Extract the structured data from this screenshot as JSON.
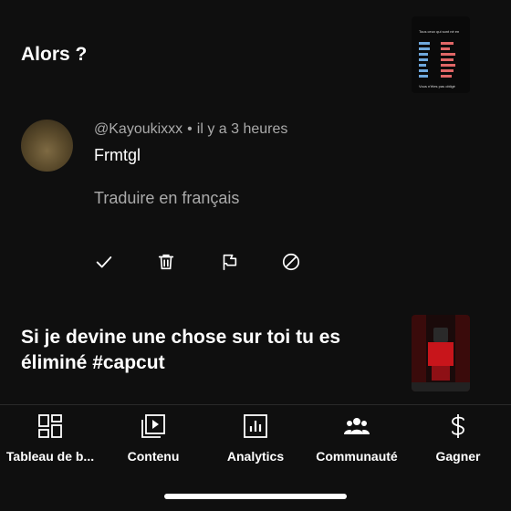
{
  "videos": [
    {
      "title": "Alors ?"
    },
    {
      "title": "Si je devine une chose sur toi tu es éliminé #capcut"
    }
  ],
  "thumb1": {
    "heading": "Tous ceux qui sont né en",
    "footer": "Vous n'êtes pas obligé"
  },
  "comment": {
    "author": "@Kayoukixxx",
    "separator": "•",
    "time": "il y a 3 heures",
    "text": "Frmtgl",
    "translate_label": "Traduire en français"
  },
  "actions": {
    "icons": [
      "check-icon",
      "trash-icon",
      "flag-icon",
      "block-icon"
    ]
  },
  "nav": {
    "items": [
      {
        "label": "Tableau de b...",
        "icon": "dashboard-icon"
      },
      {
        "label": "Contenu",
        "icon": "content-icon"
      },
      {
        "label": "Analytics",
        "icon": "analytics-icon"
      },
      {
        "label": "Communauté",
        "icon": "community-icon"
      },
      {
        "label": "Gagner",
        "icon": "dollar-icon"
      }
    ]
  },
  "colors": {
    "background": "#0f0f0f",
    "text_primary": "#ffffff",
    "text_secondary": "#aaaaaa"
  }
}
